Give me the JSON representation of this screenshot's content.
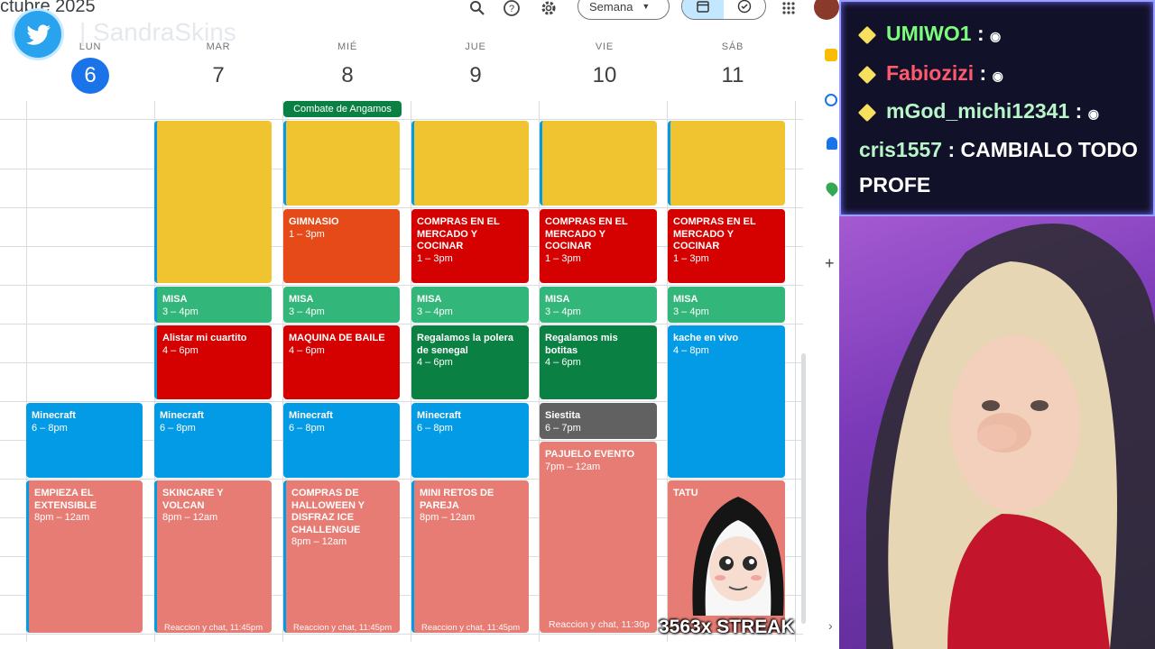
{
  "header": {
    "title": "ctubre 2025",
    "view_label": "Semana",
    "watermark": "| SandraSkins"
  },
  "days": [
    {
      "abbr": "LUN",
      "num": "6",
      "today": true
    },
    {
      "abbr": "MAR",
      "num": "7"
    },
    {
      "abbr": "MIÉ",
      "num": "8"
    },
    {
      "abbr": "JUE",
      "num": "9"
    },
    {
      "abbr": "VIE",
      "num": "10"
    },
    {
      "abbr": "SÁB",
      "num": "11"
    }
  ],
  "all_day": {
    "label": "Combate de Angamos"
  },
  "events": {
    "mon_minecraft": {
      "title": "Minecraft",
      "time": "6 – 8pm"
    },
    "mon_empieza": {
      "title": "EMPIEZA EL EXTENSIBLE",
      "time": "8pm – 12am"
    },
    "tue_alistar": {
      "title": "Alistar mi cuartito",
      "time": "4 – 6pm"
    },
    "tue_misa": {
      "title": "MISA",
      "time": "3 – 4pm"
    },
    "tue_minecraft": {
      "title": "Minecraft",
      "time": "6 – 8pm"
    },
    "tue_skincare": {
      "title": "SKINCARE Y VOLCAN",
      "time": "8pm – 12am",
      "more": "Reaccion y chat, 11:45pm"
    },
    "wed_gimnasio": {
      "title": "GIMNASIO",
      "time": "1 – 3pm"
    },
    "wed_misa": {
      "title": "MISA",
      "time": "3 – 4pm"
    },
    "wed_maquina": {
      "title": "MAQUINA DE BAILE",
      "time": "4 – 6pm"
    },
    "wed_minecraft": {
      "title": "Minecraft",
      "time": "6 – 8pm"
    },
    "wed_compras": {
      "title": "COMPRAS DE HALLOWEEN Y DISFRAZ ICE CHALLENGUE",
      "time": "8pm – 12am",
      "more": "Reaccion y chat, 11:45pm"
    },
    "thu_compras": {
      "title": "COMPRAS EN EL MERCADO Y COCINAR",
      "time": "1 – 3pm"
    },
    "thu_misa": {
      "title": "MISA",
      "time": "3 – 4pm"
    },
    "thu_regalamos": {
      "title": "Regalamos la polera de senegal",
      "time": "4 – 6pm"
    },
    "thu_minecraft": {
      "title": "Minecraft",
      "time": "6 – 8pm"
    },
    "thu_retos": {
      "title": "MINI RETOS DE PAREJA",
      "time": "8pm – 12am",
      "more": "Reaccion y chat, 11:45pm"
    },
    "fri_compras": {
      "title": "COMPRAS EN EL MERCADO Y COCINAR",
      "time": "1 – 3pm"
    },
    "fri_misa": {
      "title": "MISA",
      "time": "3 – 4pm"
    },
    "fri_botitas": {
      "title": "Regalamos mis botitas",
      "time": "4 – 6pm"
    },
    "fri_siestita": {
      "title": "Siestita",
      "time": "6 – 7pm"
    },
    "fri_pajuelo": {
      "title": "PAJUELO EVENTO",
      "time": "7pm – 12am",
      "more": "Reaccion y chat, 11:30p"
    },
    "sat_compras": {
      "title": "COMPRAS EN EL MERCADO Y COCINAR",
      "time": "1 – 3pm"
    },
    "sat_misa": {
      "title": "MISA",
      "time": "3 – 4pm"
    },
    "sat_kache": {
      "title": "kache en vivo",
      "time": "4 – 8pm"
    },
    "sat_tatu": {
      "title": "TATU"
    }
  },
  "chat": [
    {
      "user": "UMIWO1",
      "message": ":",
      "color": "#7CFC7C"
    },
    {
      "user": "Fabiozizi",
      "message": ":",
      "color": "#ff5a6b"
    },
    {
      "user": "mGod_michi12341",
      "message": ":",
      "color": "#b8f5c8"
    },
    {
      "user": "cris1557",
      "message": ": CAMBIALO TODO",
      "color": "#b8f5c8"
    },
    {
      "message": "PROFE"
    }
  ],
  "overlay": {
    "streak": "3563x STREAK"
  },
  "colors": {
    "yellow": "#f0c431",
    "red": "#d50000",
    "orange": "#e64a19",
    "green": "#33b679",
    "dark_green": "#0b8043",
    "blue": "#039be5",
    "pink": "#e67c73",
    "gray": "#616161",
    "today": "#1a73e8"
  }
}
